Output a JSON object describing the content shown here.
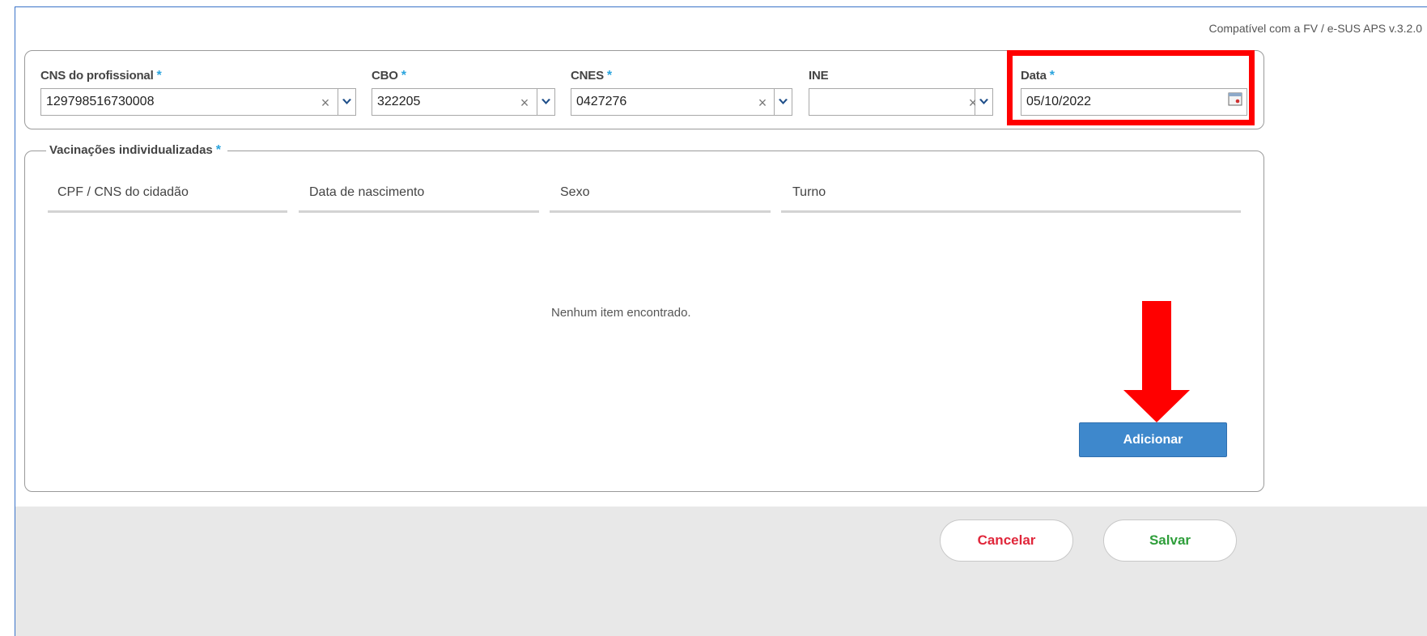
{
  "compat_text": "Compatível com a FV / e-SUS APS v.3.2.0",
  "fields": {
    "cns": {
      "label": "CNS do profissional",
      "required": "*",
      "value": "129798516730008"
    },
    "cbo": {
      "label": "CBO",
      "required": "*",
      "value": "322205"
    },
    "cnes": {
      "label": "CNES",
      "required": "*",
      "value": "0427276"
    },
    "ine": {
      "label": "INE",
      "value": ""
    },
    "data": {
      "label": "Data",
      "required": "*",
      "value": "05/10/2022"
    }
  },
  "vacinacoes": {
    "legend": "Vacinações individualizadas",
    "required": "*",
    "columns": [
      "CPF / CNS do cidadão",
      "Data de nascimento",
      "Sexo",
      "Turno"
    ],
    "empty_message": "Nenhum item encontrado.",
    "add_label": "Adicionar"
  },
  "footer": {
    "cancel_label": "Cancelar",
    "save_label": "Salvar"
  },
  "colors": {
    "highlight": "#ff0000",
    "arrow": "#ff0000",
    "primary": "#3e88cc",
    "required": "#2aa4dd",
    "cancel": "#e0263a",
    "save": "#2e9e3a"
  },
  "icons": {
    "clear": "close-icon",
    "dropdown": "chevron-down-icon",
    "calendar": "calendar-icon"
  }
}
